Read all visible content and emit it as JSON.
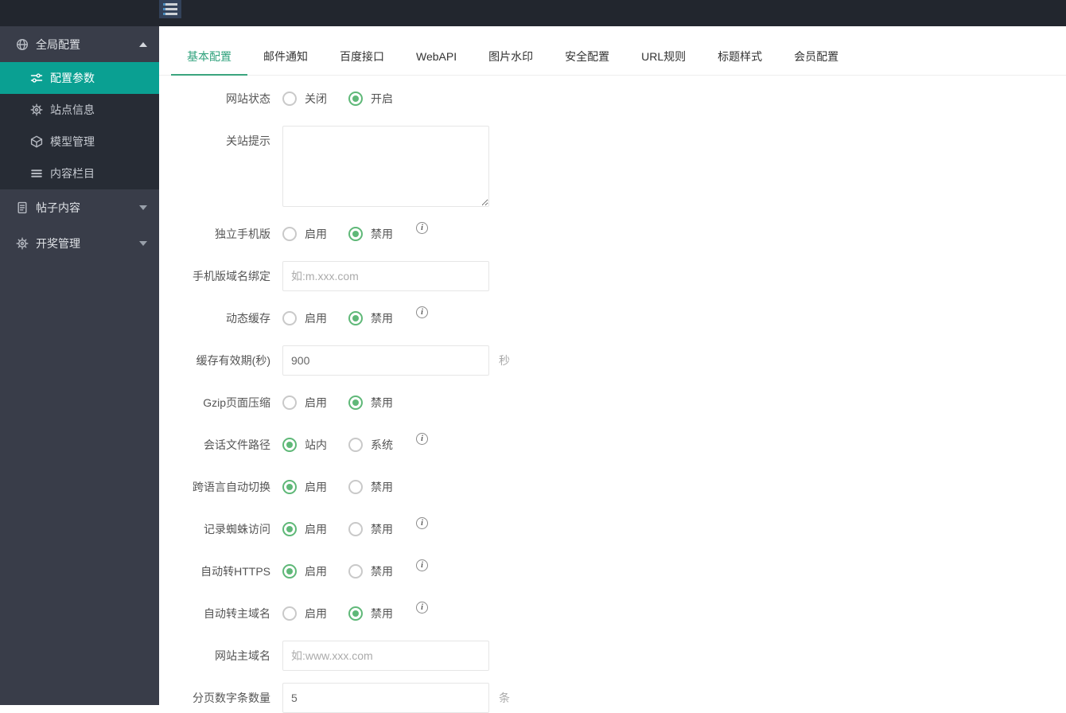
{
  "colors": {
    "topbar_bg": "#22262E",
    "sidebar_bg": "#393D49",
    "submenu_bg": "#272C35",
    "sidebar_active_bg": "#0AA092",
    "tab_active_green": "#2FA17C",
    "radio_checked_green": "#5FB878",
    "menu_btn_bg": "#33425A"
  },
  "topbar": {
    "menu_icon": "hamburger-icon"
  },
  "sidebar": {
    "items": [
      {
        "key": "global-config",
        "label": "全局配置",
        "icon": "globe-icon",
        "expanded": true,
        "active": false,
        "children": [
          {
            "key": "config-params",
            "label": "配置参数",
            "icon": "sliders-icon",
            "active": true
          },
          {
            "key": "site-info",
            "label": "站点信息",
            "icon": "gear-icon",
            "active": false
          },
          {
            "key": "model-manage",
            "label": "模型管理",
            "icon": "cube-icon",
            "active": false
          },
          {
            "key": "content-columns",
            "label": "内容栏目",
            "icon": "list-icon",
            "active": false
          }
        ]
      },
      {
        "key": "post-content",
        "label": "帖子内容",
        "icon": "document-icon",
        "expanded": false,
        "children": []
      },
      {
        "key": "lottery-manage",
        "label": "开奖管理",
        "icon": "gear-icon",
        "expanded": false,
        "children": []
      }
    ]
  },
  "tabs": [
    {
      "key": "basic",
      "label": "基本配置",
      "active": true
    },
    {
      "key": "email",
      "label": "邮件通知",
      "active": false
    },
    {
      "key": "baidu",
      "label": "百度接口",
      "active": false
    },
    {
      "key": "webapi",
      "label": "WebAPI",
      "active": false
    },
    {
      "key": "watermark",
      "label": "图片水印",
      "active": false
    },
    {
      "key": "security",
      "label": "安全配置",
      "active": false
    },
    {
      "key": "url-rules",
      "label": "URL规则",
      "active": false
    },
    {
      "key": "title-style",
      "label": "标题样式",
      "active": false
    },
    {
      "key": "member",
      "label": "会员配置",
      "active": false
    }
  ],
  "form": {
    "rows": [
      {
        "key": "site-status",
        "type": "radio",
        "label": "网站状态",
        "info": false,
        "options": [
          {
            "label": "关闭",
            "checked": false
          },
          {
            "label": "开启",
            "checked": true
          }
        ]
      },
      {
        "key": "close-tip",
        "type": "textarea",
        "label": "关站提示",
        "value": "",
        "placeholder": ""
      },
      {
        "key": "mobile-version",
        "type": "radio",
        "label": "独立手机版",
        "info": true,
        "options": [
          {
            "label": "启用",
            "checked": false
          },
          {
            "label": "禁用",
            "checked": true
          }
        ]
      },
      {
        "key": "mobile-domain",
        "type": "input",
        "label": "手机版域名绑定",
        "value": "",
        "placeholder": "如:m.xxx.com",
        "suffix": ""
      },
      {
        "key": "dynamic-cache",
        "type": "radio",
        "label": "动态缓存",
        "info": true,
        "options": [
          {
            "label": "启用",
            "checked": false
          },
          {
            "label": "禁用",
            "checked": true
          }
        ]
      },
      {
        "key": "cache-expire",
        "type": "input",
        "label": "缓存有效期(秒)",
        "value": "900",
        "placeholder": "",
        "suffix": "秒"
      },
      {
        "key": "gzip",
        "type": "radio",
        "label": "Gzip页面压缩",
        "info": false,
        "options": [
          {
            "label": "启用",
            "checked": false
          },
          {
            "label": "禁用",
            "checked": true
          }
        ]
      },
      {
        "key": "session-path",
        "type": "radio",
        "label": "会话文件路径",
        "info": true,
        "options": [
          {
            "label": "站内",
            "checked": true
          },
          {
            "label": "系统",
            "checked": false
          }
        ]
      },
      {
        "key": "lang-switch",
        "type": "radio",
        "label": "跨语言自动切换",
        "info": false,
        "options": [
          {
            "label": "启用",
            "checked": true
          },
          {
            "label": "禁用",
            "checked": false
          }
        ]
      },
      {
        "key": "spider-log",
        "type": "radio",
        "label": "记录蜘蛛访问",
        "info": true,
        "options": [
          {
            "label": "启用",
            "checked": true
          },
          {
            "label": "禁用",
            "checked": false
          }
        ]
      },
      {
        "key": "https-redirect",
        "type": "radio",
        "label": "自动转HTTPS",
        "info": true,
        "options": [
          {
            "label": "启用",
            "checked": true
          },
          {
            "label": "禁用",
            "checked": false
          }
        ]
      },
      {
        "key": "main-domain-redirect",
        "type": "radio",
        "label": "自动转主域名",
        "info": true,
        "options": [
          {
            "label": "启用",
            "checked": false
          },
          {
            "label": "禁用",
            "checked": true
          }
        ]
      },
      {
        "key": "main-domain",
        "type": "input",
        "label": "网站主域名",
        "value": "",
        "placeholder": "如:www.xxx.com",
        "suffix": ""
      },
      {
        "key": "page-number-count",
        "type": "input",
        "label": "分页数字条数量",
        "value": "5",
        "placeholder": "",
        "suffix": "条"
      }
    ]
  }
}
